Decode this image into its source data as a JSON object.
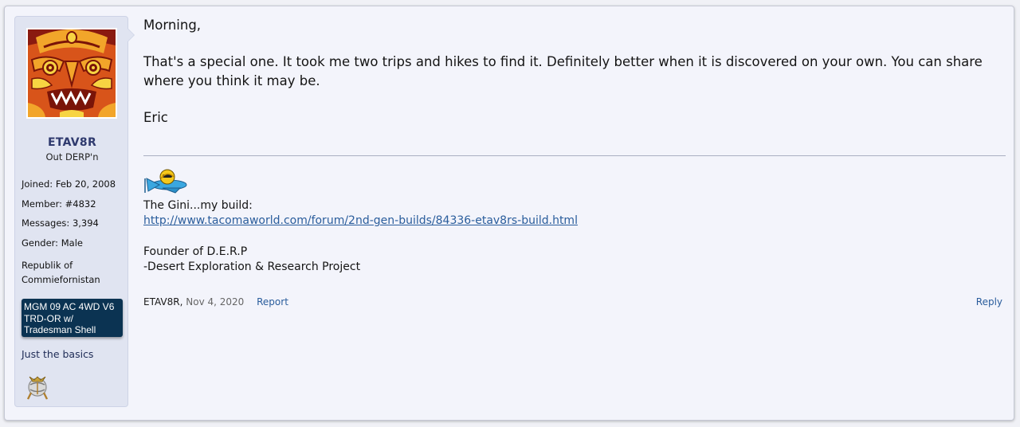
{
  "user": {
    "username": "ETAV8R",
    "title": "Out DERP'n",
    "joined_label": "Joined:",
    "joined_value": "Feb 20, 2008",
    "member_label": "Member:",
    "member_value": "#4832",
    "messages_label": "Messages:",
    "messages_value": "3,394",
    "gender_label": "Gender:",
    "gender_value": "Male",
    "location_line1": "Republik of",
    "location_line2": "Commiefornistan",
    "vehicle_line1": "MGM 09 AC 4WD V6",
    "vehicle_line2": "TRD-OR w/",
    "vehicle_line3": "Tradesman Shell",
    "vehicle_bg": "#0b3352",
    "basics": "Just the basics",
    "emblem_icon": "usmc-emblem-icon",
    "avatar_icon": "psychedelic-face-avatar"
  },
  "message": {
    "greeting": "Morning,",
    "body": "That's a special one. It took me two trips and hikes to find it. Definitely better when it is discovered on your own. You can share where you think it may be.",
    "signoff": "Eric"
  },
  "signature": {
    "icon": "airplane-icon",
    "line1": "The Gini...my build:",
    "link": "http://www.tacomaworld.com/forum/2nd-gen-builds/84336-etav8rs-build.html",
    "line3": "Founder of D.E.R.P",
    "line4": "-Desert Exploration & Research Project"
  },
  "footer": {
    "author": "ETAV8R,",
    "date": "Nov 4, 2020",
    "report": "Report",
    "reply": "Reply"
  },
  "colors": {
    "link": "#2a5d9c",
    "username": "#2f3a6e",
    "userblock_bg": "#e0e4f1"
  }
}
